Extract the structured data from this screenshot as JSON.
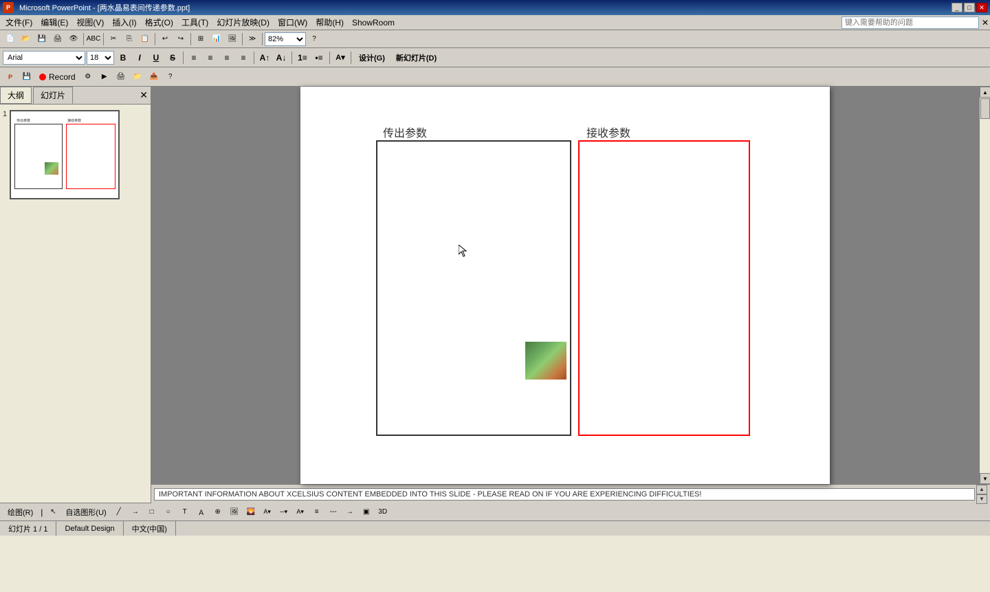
{
  "titleBar": {
    "title": "Microsoft PowerPoint - [两水晶易表间传递参数.ppt]",
    "icon": "PPT",
    "winButtons": [
      "_",
      "□",
      "×"
    ]
  },
  "menuBar": {
    "items": [
      "文件(F)",
      "编辑(E)",
      "视图(V)",
      "插入(I)",
      "格式(O)",
      "工具(T)",
      "幻灯片放映(D)",
      "窗口(W)",
      "帮助(H)",
      "ShowRoom"
    ]
  },
  "toolbar1": {
    "buttons": [
      "new",
      "open",
      "save",
      "print",
      "preview",
      "spelling",
      "cut",
      "copy",
      "paste",
      "undo",
      "redo",
      "insert-table",
      "insert-chart",
      "insert-clip",
      "zoom"
    ]
  },
  "zoomValue": "82%",
  "formatBar": {
    "font": "Arial",
    "size": "18",
    "bold": "B",
    "italic": "I",
    "underline": "U",
    "strikethrough": "S",
    "align_left": "≡",
    "align_center": "≡",
    "align_right": "≡",
    "design": "设计(G)",
    "new_slide": "新幻灯片(D)"
  },
  "customToolbar": {
    "recordLabel": "Record"
  },
  "searchBox": {
    "placeholder": "键入需要帮助的问题"
  },
  "leftPanel": {
    "tabs": [
      "大纲",
      "幻灯片"
    ],
    "activeTab": "幻灯片",
    "slideNumber": "1"
  },
  "slide": {
    "leftBoxLabel": "传出参数",
    "rightBoxLabel": "接收参数"
  },
  "bottomInfo": {
    "text": "IMPORTANT INFORMATION ABOUT XCELSIUS CONTENT EMBEDDED INTO THIS SLIDE - PLEASE READ ON IF YOU ARE EXPERIENCING DIFFICULTIES!"
  },
  "drawingToolbar": {
    "drawLabel": "绘图(R)",
    "autoShapes": "自选图形(U)"
  },
  "statusBar": {
    "slideInfo": "幻灯片 1 / 1",
    "design": "Default Design",
    "language": "中文(中国)"
  }
}
